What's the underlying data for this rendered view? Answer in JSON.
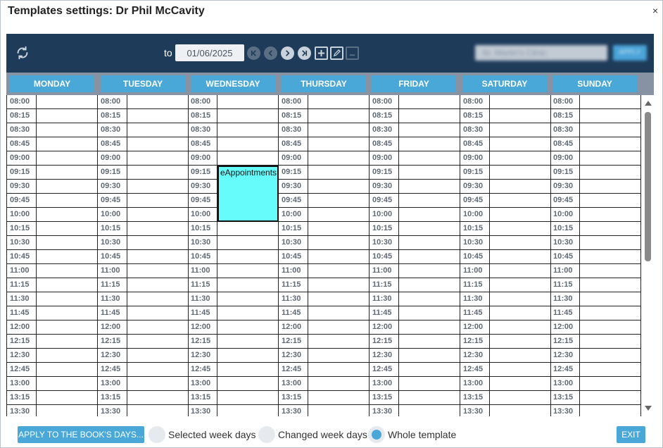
{
  "window": {
    "title": "Templates settings: Dr Phil McCavity",
    "close_glyph": "×"
  },
  "toolbar": {
    "refresh_icon": "refresh-icon",
    "to_label": "to",
    "date_value": "01/06/2025",
    "location_select_blurred": "St. Martin's Clinic",
    "apply_blurred": "APPLY"
  },
  "days": [
    "MONDAY",
    "TUESDAY",
    "WEDNESDAY",
    "THURSDAY",
    "FRIDAY",
    "SATURDAY",
    "SUNDAY"
  ],
  "times": [
    "08:00",
    "08:15",
    "08:30",
    "08:45",
    "09:00",
    "09:15",
    "09:30",
    "09:45",
    "10:00",
    "10:15",
    "10:30",
    "10:45",
    "11:00",
    "11:15",
    "11:30",
    "11:45",
    "12:00",
    "12:15",
    "12:30",
    "12:45",
    "13:00",
    "13:15",
    "13:30"
  ],
  "appointments": [
    {
      "day_index": 2,
      "start_index": 5,
      "slots": 4,
      "label": "eAppointments",
      "color": "#66fcfc"
    }
  ],
  "footer": {
    "apply_button": "APPLY TO THE BOOK'S DAYS...",
    "radio_options": [
      {
        "label": "Selected week days",
        "selected": false
      },
      {
        "label": "Changed week days",
        "selected": false
      },
      {
        "label": "Whole template",
        "selected": true
      }
    ],
    "exit_button": "EXIT"
  },
  "colors": {
    "toolbar_bg": "#1e3b5a",
    "accent": "#4aa8d8",
    "day_header_bg": "#8793a3",
    "appointment": "#66fcfc"
  }
}
